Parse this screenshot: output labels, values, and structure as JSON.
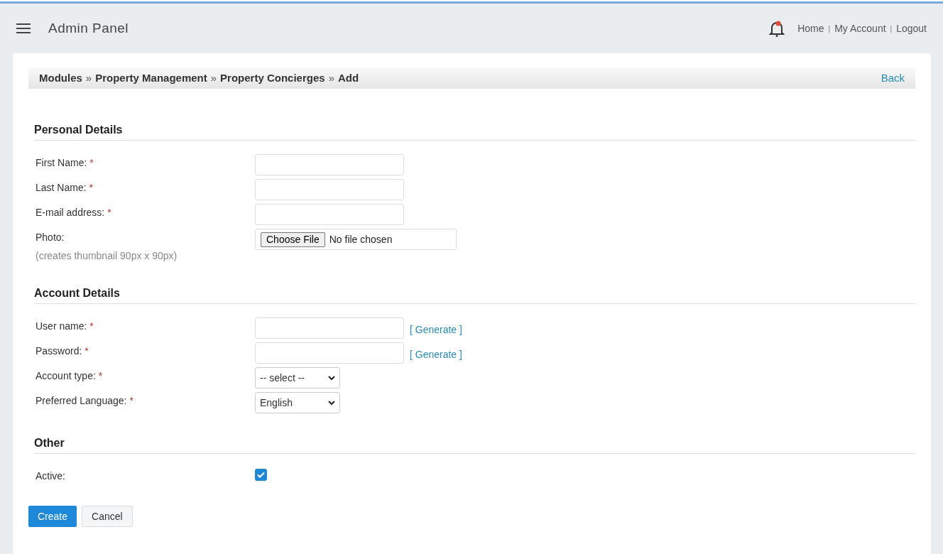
{
  "header": {
    "title": "Admin Panel",
    "notification_dot": true,
    "links": [
      "Home",
      "My Account",
      "Logout"
    ],
    "separator": "|"
  },
  "breadcrumb": {
    "items": [
      "Modules",
      "Property Management",
      "Property Concierges",
      "Add"
    ],
    "separator": "»",
    "back": "Back"
  },
  "sections": [
    {
      "title": "Personal Details",
      "fields": [
        {
          "kind": "text",
          "label": "First Name:",
          "required_mark": "*"
        },
        {
          "kind": "text",
          "label": "Last Name:",
          "required_mark": "*"
        },
        {
          "kind": "text",
          "label": "E-mail address:",
          "required_mark": "*"
        },
        {
          "kind": "file",
          "label": "Photo:",
          "hint": "(creates thumbnail 90px x 90px)",
          "button": "Choose File",
          "value": "No file chosen"
        }
      ]
    },
    {
      "title": "Account Details",
      "fields": [
        {
          "kind": "text",
          "label": "User name:",
          "required_mark": "*",
          "action": "[ Generate ]"
        },
        {
          "kind": "text",
          "label": "Password:",
          "required_mark": "*",
          "action": "[ Generate ]"
        },
        {
          "kind": "select",
          "label": "Account type:",
          "required_mark": "*",
          "value": "-- select --"
        },
        {
          "kind": "select",
          "label": "Preferred Language:",
          "required_mark": "*",
          "value": "English"
        }
      ]
    },
    {
      "title": "Other",
      "fields": [
        {
          "kind": "checkbox",
          "label": "Active:",
          "checked": true
        }
      ]
    }
  ],
  "buttons": [
    {
      "label": "Create",
      "primary": true
    },
    {
      "label": "Cancel",
      "primary": false
    }
  ]
}
